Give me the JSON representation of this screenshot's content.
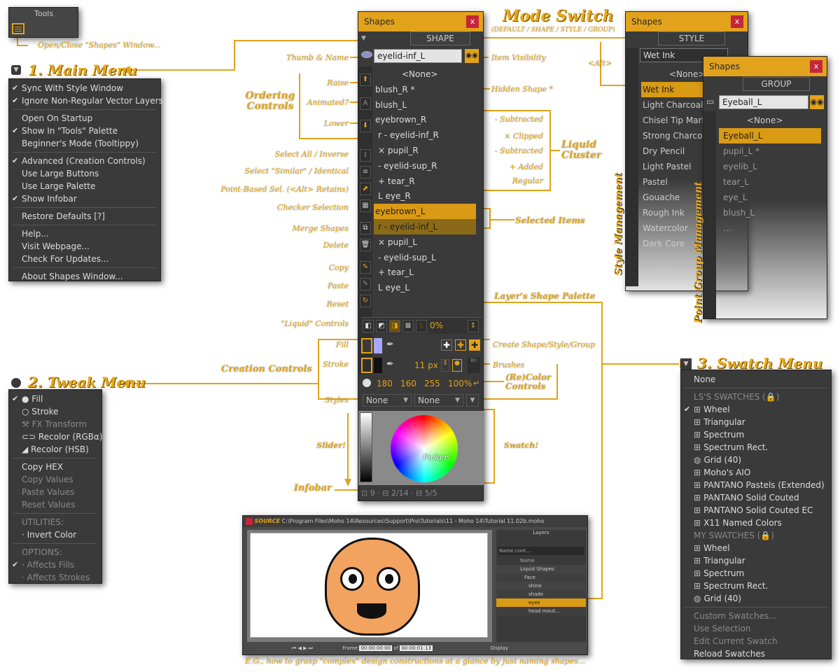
{
  "tools_panel": {
    "title": "Tools"
  },
  "main_menu": {
    "heading": "1. Main Menu",
    "items": [
      {
        "label": "Sync With Style Window",
        "checked": true
      },
      {
        "label": "Ignore Non-Regular Vector Layers",
        "checked": true
      },
      {
        "sep": true
      },
      {
        "label": "Open On Startup",
        "checked": false
      },
      {
        "label": "Show In \"Tools\" Palette",
        "checked": true
      },
      {
        "label": "Beginner's Mode (Tooltippy)",
        "checked": false
      },
      {
        "sep": true
      },
      {
        "label": "Advanced (Creation Controls)",
        "checked": true
      },
      {
        "label": "Use Large Buttons",
        "checked": false
      },
      {
        "label": "Use Large Palette",
        "checked": false
      },
      {
        "label": "Show Infobar",
        "checked": true
      },
      {
        "sep": true
      },
      {
        "label": "Restore Defaults [?]",
        "checked": false
      },
      {
        "sep": true
      },
      {
        "label": "Help...",
        "checked": false
      },
      {
        "label": "Visit Webpage...",
        "checked": false
      },
      {
        "label": "Check For Updates...",
        "checked": false
      },
      {
        "sep": true
      },
      {
        "label": "About Shapes Window...",
        "checked": false
      }
    ]
  },
  "tweak_menu": {
    "heading": "2. Tweak Menu",
    "items": [
      {
        "label": "● Fill",
        "checked": true,
        "dim": false
      },
      {
        "label": "○ Stroke",
        "checked": false,
        "dim": false
      },
      {
        "label": "⚒ FX Transform",
        "checked": false,
        "dim": true
      },
      {
        "label": "⊂⊃ Recolor (RGBα)",
        "checked": false,
        "dim": false
      },
      {
        "label": "◢ Recolor (HSB)",
        "checked": false,
        "dim": false
      },
      {
        "sep": true
      },
      {
        "label": "Copy HEX",
        "checked": false,
        "dim": false
      },
      {
        "label": "Copy Values",
        "checked": false,
        "dim": true
      },
      {
        "label": "Paste Values",
        "checked": false,
        "dim": true
      },
      {
        "label": "Reset Values",
        "checked": false,
        "dim": true
      },
      {
        "sep": true
      },
      {
        "label": "UTILITIES:",
        "checked": false,
        "dim": true
      },
      {
        "label": "· Invert Color",
        "checked": false,
        "dim": false
      },
      {
        "sep": true
      },
      {
        "label": "OPTIONS:",
        "checked": false,
        "dim": true
      },
      {
        "label": "· Affects Fills",
        "checked": true,
        "dim": true
      },
      {
        "label": "· Affects Strokes",
        "checked": false,
        "dim": true
      }
    ]
  },
  "swatch_menu": {
    "heading": "3. Swatch Menu",
    "items": [
      {
        "label": "None",
        "checked": false,
        "dim": false,
        "icon": ""
      },
      {
        "sep": true
      },
      {
        "label": "LS'S SWATCHES (🔒)",
        "checked": false,
        "dim": true,
        "icon": ""
      },
      {
        "label": "Wheel",
        "checked": true,
        "dim": false,
        "icon": "⊞"
      },
      {
        "label": "Triangular",
        "checked": false,
        "dim": false,
        "icon": "⊞"
      },
      {
        "label": "Spectrum",
        "checked": false,
        "dim": false,
        "icon": "⊞"
      },
      {
        "label": "Spectrum Rect.",
        "checked": false,
        "dim": false,
        "icon": "⊞"
      },
      {
        "label": "Grid (40)",
        "checked": false,
        "dim": false,
        "icon": "◍"
      },
      {
        "label": "Moho's AIO",
        "checked": false,
        "dim": false,
        "icon": "⊞"
      },
      {
        "label": "PANTANO Pastels (Extended)",
        "checked": false,
        "dim": false,
        "icon": "⊞"
      },
      {
        "label": "PANTANO Solid Couted",
        "checked": false,
        "dim": false,
        "icon": "⊞"
      },
      {
        "label": "PANTANO Solid Couted EC",
        "checked": false,
        "dim": false,
        "icon": "⊞"
      },
      {
        "label": "X11 Named Colors",
        "checked": false,
        "dim": false,
        "icon": "⊞"
      },
      {
        "label": "MY SWATCHES (🔒)",
        "checked": false,
        "dim": true,
        "icon": ""
      },
      {
        "label": "Wheel",
        "checked": false,
        "dim": false,
        "icon": "⊞"
      },
      {
        "label": "Triangular",
        "checked": false,
        "dim": false,
        "icon": "⊞"
      },
      {
        "label": "Spectrum",
        "checked": false,
        "dim": false,
        "icon": "⊞"
      },
      {
        "label": "Spectrum Rect.",
        "checked": false,
        "dim": false,
        "icon": "⊞"
      },
      {
        "label": "Grid (40)",
        "checked": false,
        "dim": false,
        "icon": "◍"
      },
      {
        "sep": true
      },
      {
        "label": "Custom Swatches...",
        "checked": false,
        "dim": true,
        "icon": ""
      },
      {
        "label": "Use Selection",
        "checked": false,
        "dim": true,
        "icon": ""
      },
      {
        "label": "Edit Current Swatch",
        "checked": false,
        "dim": true,
        "icon": ""
      },
      {
        "label": "Reload Swatches",
        "checked": false,
        "dim": false,
        "icon": ""
      }
    ]
  },
  "shapes_window": {
    "title": "Shapes",
    "close": "x",
    "mode": "SHAPE",
    "name_field": "eyelid-inf_L",
    "rows": [
      {
        "label": "<None>",
        "indent": 0,
        "selected": false,
        "center": true
      },
      {
        "label": "blush_R *",
        "indent": 0,
        "selected": false
      },
      {
        "label": "blush_L",
        "indent": 0,
        "selected": false
      },
      {
        "label": "eyebrown_R",
        "indent": 0,
        "selected": false
      },
      {
        "label": "r  -  eyelid-inf_R",
        "indent": 1,
        "selected": false
      },
      {
        "label": "×  pupil_R",
        "indent": 1,
        "selected": false
      },
      {
        "label": "-  eyelid-sup_R",
        "indent": 1,
        "selected": false
      },
      {
        "label": "+  tear_R",
        "indent": 1,
        "selected": false
      },
      {
        "label": "L    eye_R",
        "indent": 1,
        "selected": false
      },
      {
        "label": "eyebrown_L",
        "indent": 0,
        "selected": true
      },
      {
        "label": "r  -  eyelid-inf_L",
        "indent": 1,
        "selected": true
      },
      {
        "label": "×  pupil_L",
        "indent": 1,
        "selected": false
      },
      {
        "label": "-  eyelid-sup_L",
        "indent": 1,
        "selected": false
      },
      {
        "label": "+  tear_L",
        "indent": 1,
        "selected": false
      },
      {
        "label": "L    eye_L",
        "indent": 1,
        "selected": false
      }
    ],
    "opacity": "0%",
    "stroke_width": "11 px",
    "h": "180",
    "s": "160",
    "b": "255",
    "alpha": "100%",
    "style1": "None",
    "style2": "None",
    "picker_label": "Picker!",
    "infobar": [
      "9",
      "2/14",
      "5/5"
    ]
  },
  "style_window": {
    "title": "Shapes",
    "mode": "STYLE",
    "name_field": "Wet Ink",
    "rows": [
      "<None>",
      "Wet Ink",
      "Light Charcoal",
      "Chisel Tip Marker",
      "Strong Charcoal",
      "Dry Pencil",
      "Light Pastel",
      "Pastel",
      "Gouache",
      "Rough Ink",
      "Watercolor",
      "Dark Core"
    ],
    "vertical_label": "Style Management"
  },
  "group_window": {
    "title": "Shapes",
    "mode": "GROUP",
    "name_field": "Eyeball_L",
    "rows": [
      "<None>",
      "Eyeball_L",
      "pupil_L *",
      "eyelib_L",
      "tear_L",
      "eye_L",
      "blush_L",
      "..."
    ],
    "vertical_label": "Point Group Management"
  },
  "annotations": {
    "mode_switch": "Mode Switch",
    "mode_switch_sub": "(DEFAULT / SHAPE / STYLE / GROUP)",
    "alt": "<Alt>",
    "open_close": "Open/Close \"Shapes\" Window...",
    "thumb_name": "Thumb & Name",
    "item_visibility": "Item Visibility",
    "raise": "Raise",
    "animated": "Animated?",
    "lower": "Lower",
    "ordering_controls": "Ordering Controls",
    "hidden_shape": "Hidden Shape *",
    "subtracted": "- Subtracted",
    "clipped": "× Clipped",
    "subtracted2": "- Subtracted",
    "added": "+ Added",
    "regular": "Regular",
    "liquid_cluster": "Liquid Cluster",
    "select_all": "Select All / Inverse",
    "select_similar": "Select \"Similar\" / Identical",
    "point_based": "Point-Based Sel. (<Alt> Retains)",
    "checker": "Checker Selection",
    "merge": "Merge Shapes",
    "delete": "Delete",
    "selected_items": "Selected Items",
    "copy": "Copy",
    "paste": "Paste",
    "reset": "Reset",
    "layer_palette": "Layer's Shape Palette",
    "liquid_controls": "\"Liquid\" Controls",
    "fill": "Fill",
    "stroke": "Stroke",
    "creation_controls": "Creation Controls",
    "create": "Create Shape/Style/Group",
    "brushes": "Brushes",
    "recolor": "(Re)Color Controls",
    "styles": "Styles",
    "slider": "Slider!",
    "swatch": "Swatch!",
    "infobar": "Infobar",
    "caption": "E.G., how to grasp \"complex\" design constructions at a glance by just naming shapes..."
  },
  "moho": {
    "title": "SOURCE",
    "path": "C:\\Program Files\\Moho 14\\Resources\\Support\\Pro\\Tutorials\\11 - Moho 14\\Tutorial 11.02b.moho",
    "layers_title": "Layers",
    "name_filter": "Name cont...",
    "name_col": "Name",
    "layers": [
      {
        "name": "Liquid Shapes",
        "selected": false
      },
      {
        "name": "Face",
        "selected": false
      },
      {
        "name": "shine",
        "selected": false
      },
      {
        "name": "shade",
        "selected": false
      },
      {
        "name": "eyes",
        "selected": true
      },
      {
        "name": "head mout...",
        "selected": false
      }
    ],
    "frame_label": "Frame",
    "frame": "00:00:00:00",
    "of": "of",
    "end": "00:00:01:13",
    "display": "Display"
  },
  "colors": {
    "accent": "#e2a21b",
    "panel": "#3a3a3a",
    "selected": "#d99a14",
    "close": "#c4263a"
  }
}
